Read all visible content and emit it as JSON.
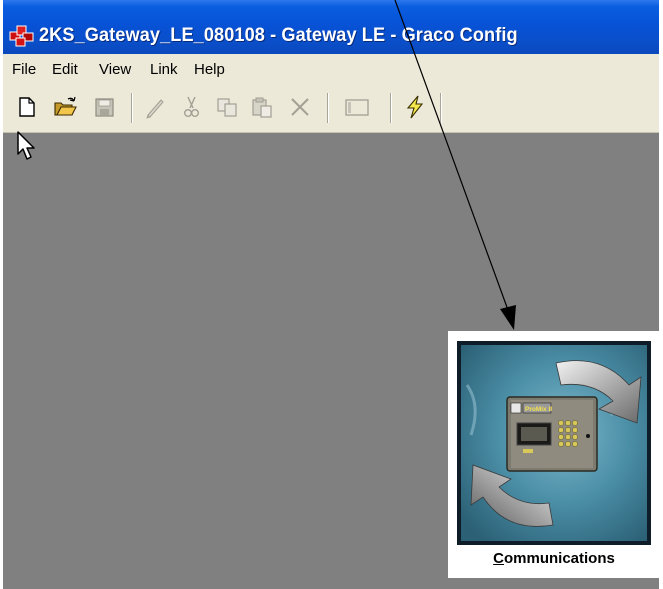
{
  "window": {
    "title": "2KS_Gateway_LE_080108 - Gateway LE - Graco Config"
  },
  "menubar": {
    "items": [
      {
        "label": "File"
      },
      {
        "label": "Edit"
      },
      {
        "label": "View"
      },
      {
        "label": "Link"
      },
      {
        "label": "Help"
      }
    ]
  },
  "toolbar": {
    "buttons": [
      {
        "name": "new-document",
        "icon": "new-document-icon",
        "enabled": true
      },
      {
        "name": "open-folder",
        "icon": "open-folder-icon",
        "enabled": true
      },
      {
        "name": "save",
        "icon": "floppy-disk-icon",
        "enabled": false
      },
      {
        "name": "edit",
        "icon": "pencil-icon",
        "enabled": false
      },
      {
        "name": "cut",
        "icon": "scissors-icon",
        "enabled": false
      },
      {
        "name": "copy",
        "icon": "copy-icon",
        "enabled": false
      },
      {
        "name": "paste",
        "icon": "paste-icon",
        "enabled": false
      },
      {
        "name": "delete",
        "icon": "x-delete-icon",
        "enabled": false
      },
      {
        "name": "properties",
        "icon": "window-rectangle-icon",
        "enabled": false
      },
      {
        "name": "connect",
        "icon": "lightning-bolt-icon",
        "enabled": true
      }
    ]
  },
  "communications": {
    "label_first": "C",
    "label_rest": "ommunications",
    "device_badge": "ProMix II",
    "icon": "communications-device-icon"
  },
  "colors": {
    "titlebar": "#0a52d6",
    "workspace": "#808080",
    "window": "#ece9d8",
    "tile_background": "#3d7b93"
  }
}
